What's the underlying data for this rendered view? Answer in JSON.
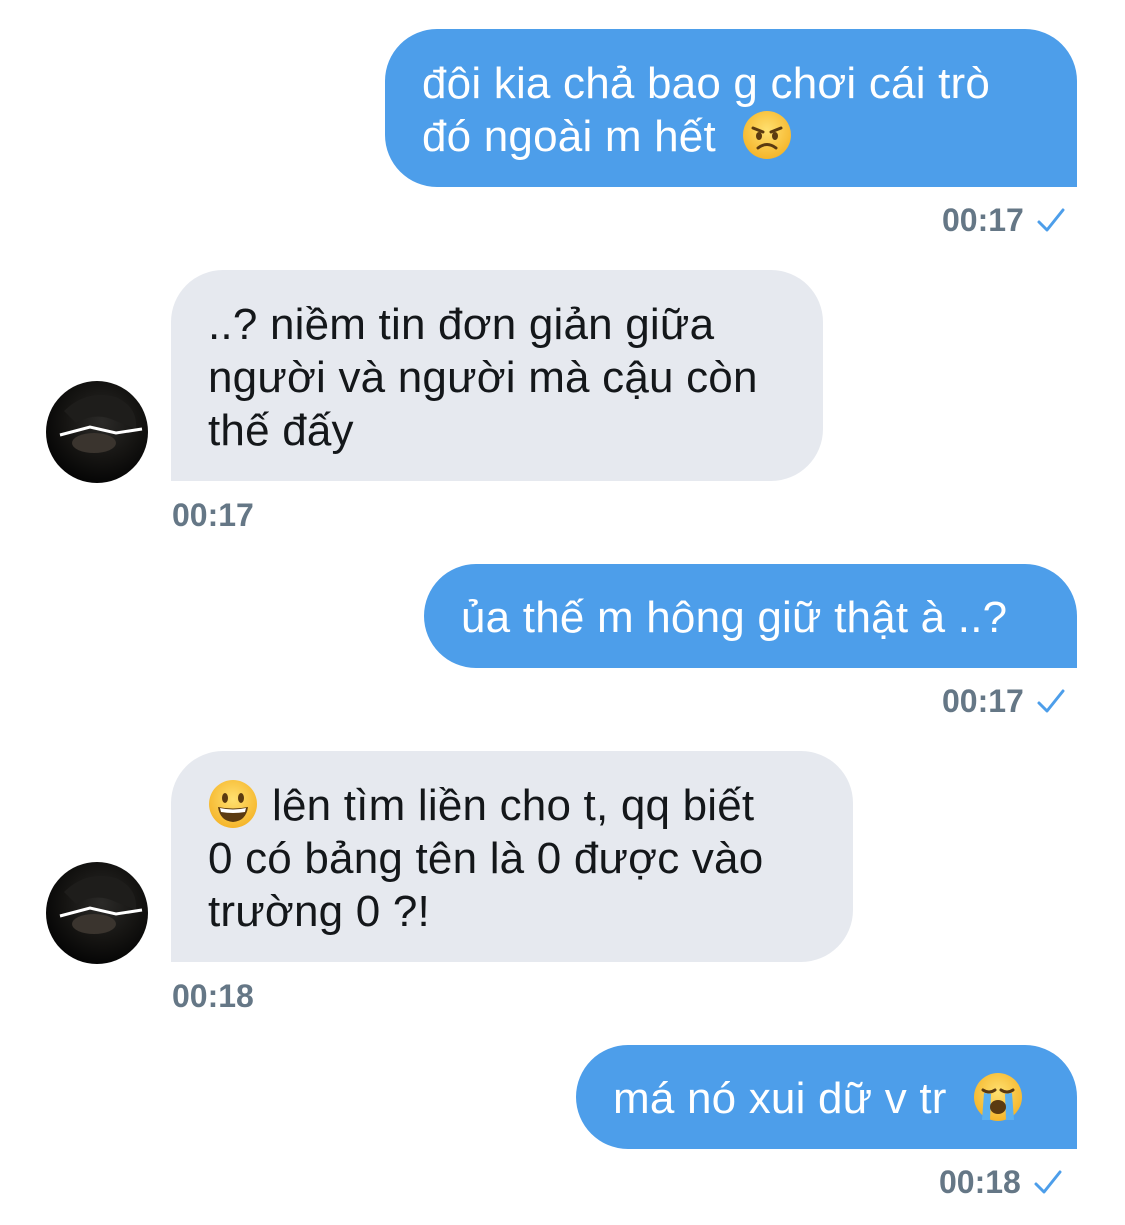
{
  "messages": [
    {
      "direction": "sent",
      "lines": [
        "đôi kia chả bao g chơi cái trò",
        "đó ngoài m hết"
      ],
      "emoji": "angry-face",
      "time": "00:17",
      "status": "sent-check"
    },
    {
      "direction": "received",
      "lines": [
        "..? niềm tin đơn giản giữa",
        "người và người mà cậu còn",
        "thế đấy"
      ],
      "time": "00:17"
    },
    {
      "direction": "sent",
      "lines": [
        "ủa thế m hông giữ thật à ..?"
      ],
      "time": "00:17",
      "status": "sent-check"
    },
    {
      "direction": "received",
      "emoji": "grinning-face",
      "lines": [
        "lên tìm liền cho t, qq biết",
        "0 có bảng tên là 0 được vào",
        "trường 0 ?!"
      ],
      "time": "00:18"
    },
    {
      "direction": "sent",
      "lines": [
        "má nó xui dữ v tr"
      ],
      "emoji": "loudly-crying-face",
      "time": "00:18",
      "status": "sent-check"
    }
  ],
  "colors": {
    "sent_bubble": "#4d9eea",
    "received_bubble": "#e6e9ef",
    "timestamp": "#657786",
    "check": "#4d9eea"
  }
}
